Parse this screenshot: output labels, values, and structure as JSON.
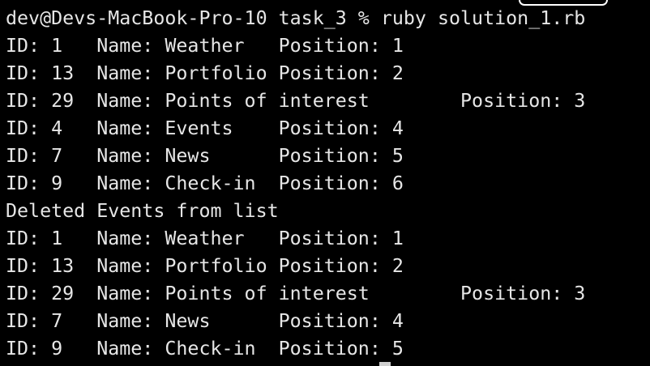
{
  "terminal": {
    "prompt": "dev@Devs-MacBook-Pro-10 task_3 % ruby solution_1.rb",
    "output": [
      "ID: 1   Name: Weather   Position: 1",
      "ID: 13  Name: Portfolio Position: 2",
      "ID: 29  Name: Points of interest        Position: 3",
      "ID: 4   Name: Events    Position: 4",
      "ID: 7   Name: News      Position: 5",
      "ID: 9   Name: Check-in  Position: 6",
      "Deleted Events from list",
      "ID: 1   Name: Weather   Position: 1",
      "ID: 13  Name: Portfolio Position: 2",
      "ID: 29  Name: Points of interest        Position: 3",
      "ID: 7   Name: News      Position: 4",
      "ID: 9   Name: Check-in  Position: 5"
    ]
  },
  "colors": {
    "background": "#000000",
    "text": "#e6e6e6"
  }
}
